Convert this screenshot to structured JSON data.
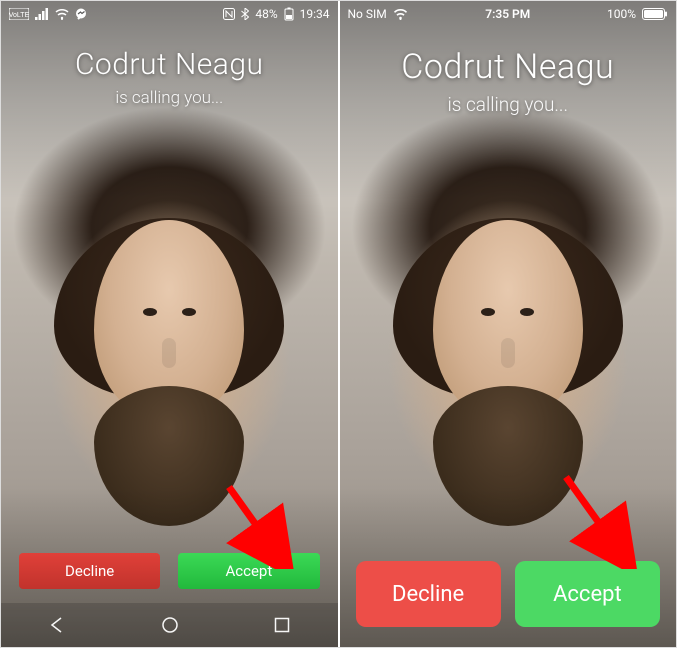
{
  "android": {
    "statusbar": {
      "battery_text": "48%",
      "time": "19:34"
    },
    "caller": {
      "name": "Codrut Neagu",
      "subtitle": "is calling you..."
    },
    "actions": {
      "decline_label": "Decline",
      "accept_label": "Accept"
    }
  },
  "ios": {
    "statusbar": {
      "carrier": "No SIM",
      "time": "7:35 PM",
      "battery_text": "100%"
    },
    "caller": {
      "name": "Codrut Neagu",
      "subtitle": "is calling you..."
    },
    "actions": {
      "decline_label": "Decline",
      "accept_label": "Accept"
    }
  },
  "colors": {
    "decline": "#e04039",
    "accept": "#2ecc47",
    "arrow": "#ff0000"
  }
}
